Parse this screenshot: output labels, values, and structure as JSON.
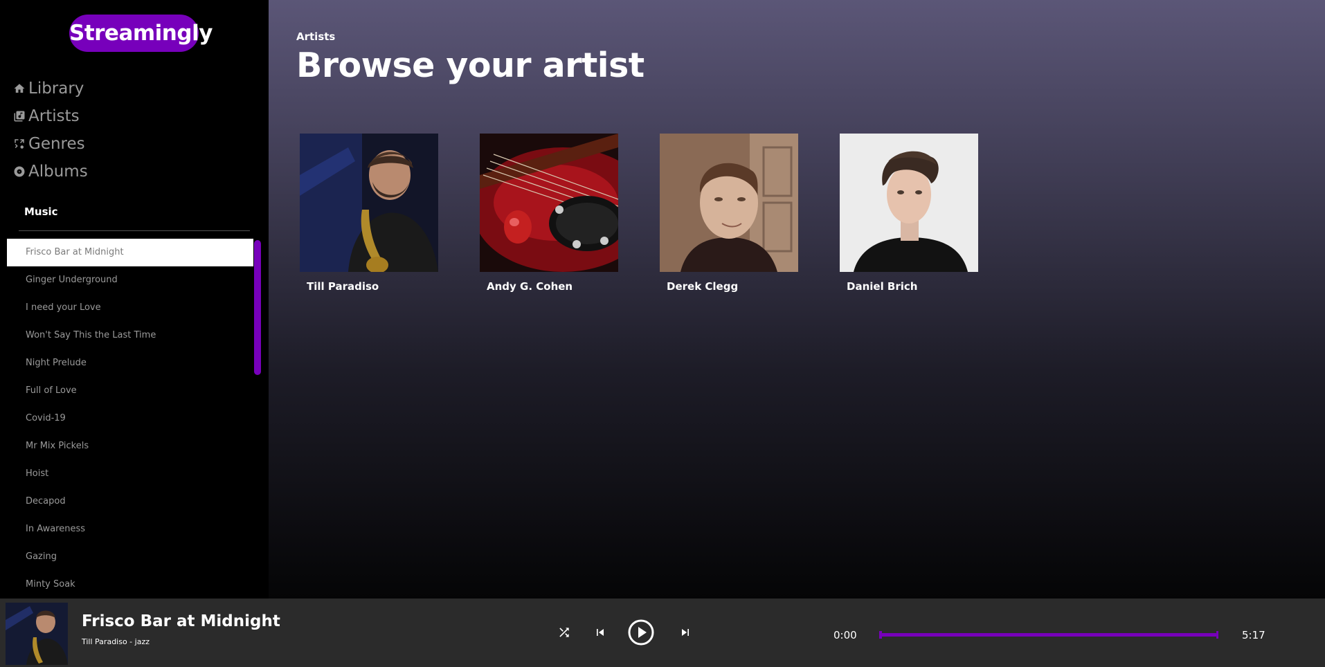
{
  "brand": {
    "name": "Streamingly",
    "color": "#7700bb"
  },
  "nav": [
    {
      "label": "Library",
      "icon": "home-icon"
    },
    {
      "label": "Artists",
      "icon": "library-music-icon"
    },
    {
      "label": "Genres",
      "icon": "genres-icon"
    },
    {
      "label": "Albums",
      "icon": "album-icon"
    }
  ],
  "music": {
    "title": "Music",
    "tracks": [
      "Frisco Bar at Midnight",
      "Ginger Underground",
      "I need your Love",
      "Won't Say This the Last Time",
      "Night Prelude",
      "Full of Love",
      "Covid-19",
      "Mr Mix Pickels",
      "Hoist",
      "Decapod",
      "In Awareness",
      "Gazing",
      "Minty Soak"
    ],
    "active_index": 0
  },
  "main": {
    "breadcrumb": "Artists",
    "heading": "Browse your artist",
    "artists": [
      {
        "name": "Till Paradiso"
      },
      {
        "name": "Andy G. Cohen"
      },
      {
        "name": "Derek Clegg"
      },
      {
        "name": "Daniel Brich"
      }
    ]
  },
  "player": {
    "title": "Frisco Bar at Midnight",
    "subtitle": "Till Paradiso - jazz",
    "elapsed": "0:00",
    "duration": "5:17",
    "progress": 0,
    "controls": [
      "shuffle-icon",
      "previous-icon",
      "play-icon",
      "next-icon"
    ]
  }
}
